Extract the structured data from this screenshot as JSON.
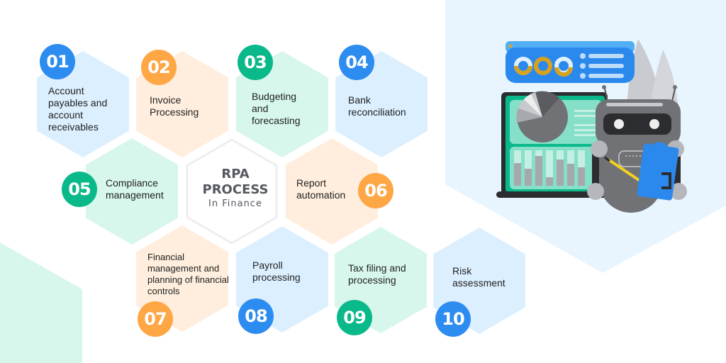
{
  "center": {
    "line1": "RPA",
    "line2": "PROCESS",
    "line3": "In Finance"
  },
  "colors": {
    "blue": "#2d8cf0",
    "orange": "#ffa645",
    "green": "#0ab98a",
    "blue_tint": "#dcefff",
    "orange_tint": "#ffeedd",
    "green_tint": "#d7f7ec",
    "title_gray": "#555860"
  },
  "steps": [
    {
      "number": "01",
      "label": "Account payables and account receivables",
      "color": "blue"
    },
    {
      "number": "02",
      "label": "Invoice Processing",
      "color": "orange"
    },
    {
      "number": "03",
      "label": "Budgeting and forecasting",
      "color": "green"
    },
    {
      "number": "04",
      "label": "Bank reconciliation",
      "color": "blue"
    },
    {
      "number": "05",
      "label": "Compliance management",
      "color": "green"
    },
    {
      "number": "06",
      "label": "Report automation",
      "color": "orange"
    },
    {
      "number": "07",
      "label": "Financial management and planning of financial controls",
      "color": "orange"
    },
    {
      "number": "08",
      "label": "Payroll processing",
      "color": "blue"
    },
    {
      "number": "09",
      "label": "Tax filing and processing",
      "color": "green"
    },
    {
      "number": "10",
      "label": "Risk assessment",
      "color": "blue"
    }
  ],
  "illustration": {
    "subject": "robot-with-dashboard"
  }
}
